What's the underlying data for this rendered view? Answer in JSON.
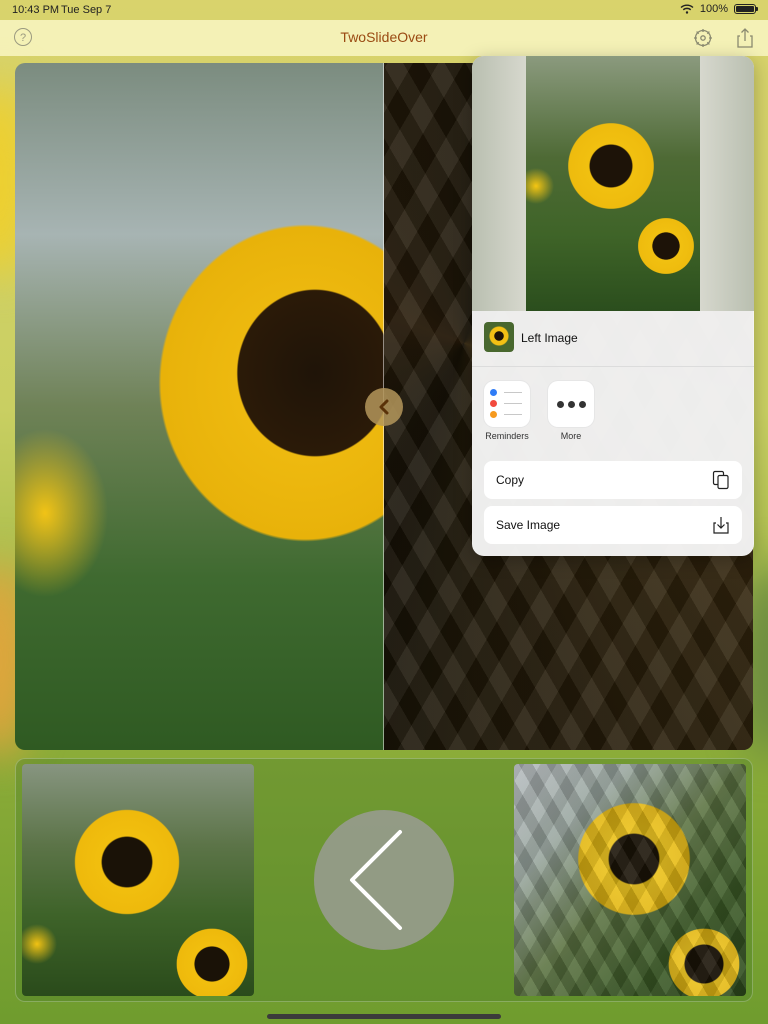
{
  "status_bar": {
    "time": "10:43 PM",
    "date": "Tue Sep 7",
    "battery": "100%",
    "battery_level": 1.0
  },
  "nav": {
    "title": "TwoSlideOver",
    "help_icon": "question-circle-icon",
    "settings_icon": "gear-icon",
    "share_icon": "share-icon"
  },
  "colors": {
    "title": "#9a4a12",
    "nav_background": "#fffcd2"
  },
  "share_sheet": {
    "item_title": "Left Image",
    "apps": [
      {
        "label": "Reminders",
        "icon": "reminders-icon"
      },
      {
        "label": "More",
        "icon": "more-icon"
      }
    ],
    "actions": [
      {
        "label": "Copy",
        "icon": "copy-icon"
      },
      {
        "label": "Save Image",
        "icon": "save-image-icon"
      }
    ]
  }
}
